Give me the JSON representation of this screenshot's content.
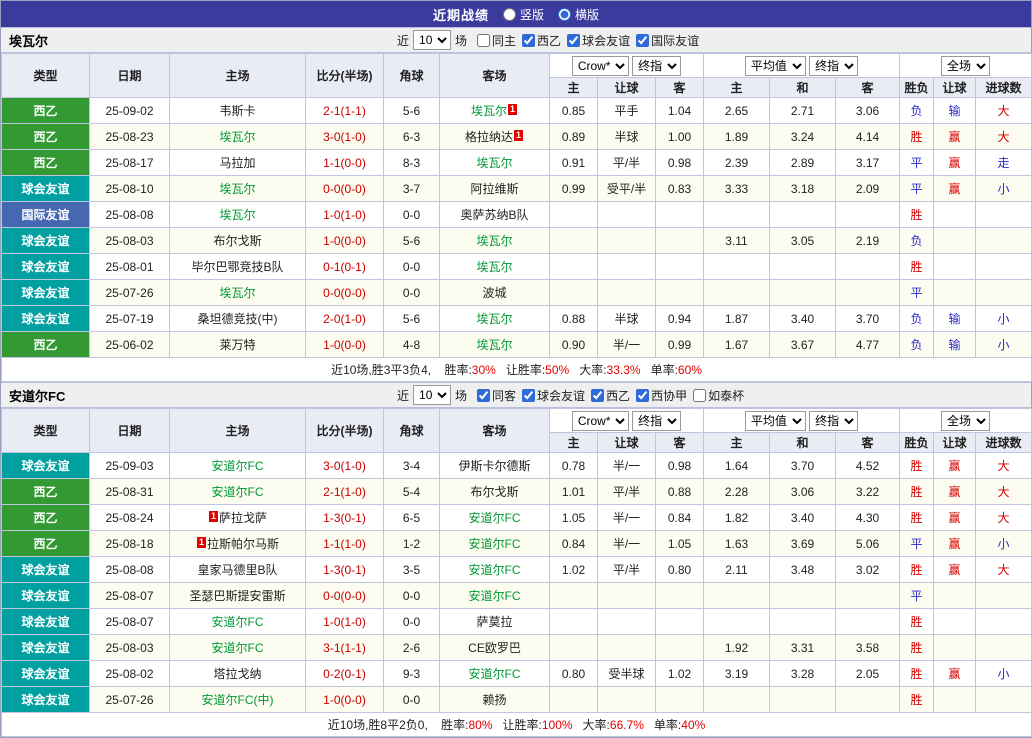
{
  "topbar": {
    "title": "近期战绩",
    "radios": [
      {
        "label": "竖版",
        "selected": false
      },
      {
        "label": "横版",
        "selected": true
      }
    ]
  },
  "columns": {
    "type": "类型",
    "date": "日期",
    "home": "主场",
    "score": "比分(半场)",
    "corner": "角球",
    "away": "客场",
    "sub_odds": [
      "主",
      "让球",
      "客"
    ],
    "sub_avg": [
      "主",
      "和",
      "客"
    ],
    "sub_result": [
      "胜负",
      "让球",
      "进球数"
    ]
  },
  "dropdowns": {
    "company": "Crow*",
    "final": "终指",
    "average": "平均值",
    "fulltime": "全场"
  },
  "type_colors": {
    "西乙": "#339933",
    "球会友谊": "#00a0a0",
    "国际友谊": "#4668b2"
  },
  "sections": [
    {
      "team": "埃瓦尔",
      "filters": {
        "recent_label": "近",
        "count": "10",
        "games_label": "场",
        "checkboxes": [
          {
            "label": "同主",
            "checked": false
          },
          {
            "label": "西乙",
            "checked": true
          },
          {
            "label": "球会友谊",
            "checked": true
          },
          {
            "label": "国际友谊",
            "checked": true
          }
        ]
      },
      "rows": [
        {
          "type": "西乙",
          "date": "25-09-02",
          "home": {
            "name": "韦斯卡"
          },
          "score": "2-1(1-1)",
          "corner": "5-6",
          "away": {
            "name": "埃瓦尔",
            "green": true,
            "card_after": "1"
          },
          "odds": [
            "0.85",
            "平手",
            "1.04"
          ],
          "avg": [
            "2.65",
            "2.71",
            "3.06"
          ],
          "result": [
            [
              "负",
              "blue"
            ],
            [
              "输",
              "blue"
            ],
            [
              "大",
              "red"
            ]
          ]
        },
        {
          "type": "西乙",
          "date": "25-08-23",
          "home": {
            "name": "埃瓦尔",
            "green": true
          },
          "score": "3-0(1-0)",
          "corner": "6-3",
          "away": {
            "name": "格拉纳达",
            "card_after": "1"
          },
          "odds": [
            "0.89",
            "半球",
            "1.00"
          ],
          "avg": [
            "1.89",
            "3.24",
            "4.14"
          ],
          "result": [
            [
              "胜",
              "red"
            ],
            [
              "赢",
              "red"
            ],
            [
              "大",
              "red"
            ]
          ]
        },
        {
          "type": "西乙",
          "date": "25-08-17",
          "home": {
            "name": "马拉加"
          },
          "score": "1-1(0-0)",
          "corner": "8-3",
          "away": {
            "name": "埃瓦尔",
            "green": true
          },
          "odds": [
            "0.91",
            "平/半",
            "0.98"
          ],
          "avg": [
            "2.39",
            "2.89",
            "3.17"
          ],
          "result": [
            [
              "平",
              "blue"
            ],
            [
              "赢",
              "red"
            ],
            [
              "走",
              "blue"
            ]
          ]
        },
        {
          "type": "球会友谊",
          "date": "25-08-10",
          "home": {
            "name": "埃瓦尔",
            "green": true
          },
          "score": "0-0(0-0)",
          "corner": "3-7",
          "away": {
            "name": "阿拉维斯"
          },
          "odds": [
            "0.99",
            "受平/半",
            "0.83"
          ],
          "avg": [
            "3.33",
            "3.18",
            "2.09"
          ],
          "result": [
            [
              "平",
              "blue"
            ],
            [
              "赢",
              "red"
            ],
            [
              "小",
              "blue"
            ]
          ]
        },
        {
          "type": "国际友谊",
          "date": "25-08-08",
          "home": {
            "name": "埃瓦尔",
            "green": true
          },
          "score": "1-0(1-0)",
          "corner": "0-0",
          "away": {
            "name": "奥萨苏纳B队"
          },
          "odds": [
            "",
            "",
            ""
          ],
          "avg": [
            "",
            "",
            ""
          ],
          "result": [
            [
              "胜",
              "red"
            ],
            [
              "",
              ""
            ],
            [
              "",
              ""
            ]
          ]
        },
        {
          "type": "球会友谊",
          "date": "25-08-03",
          "home": {
            "name": "布尔戈斯"
          },
          "score": "1-0(0-0)",
          "corner": "5-6",
          "away": {
            "name": "埃瓦尔",
            "green": true
          },
          "odds": [
            "",
            "",
            ""
          ],
          "avg": [
            "3.11",
            "3.05",
            "2.19"
          ],
          "result": [
            [
              "负",
              "blue"
            ],
            [
              "",
              ""
            ],
            [
              "",
              ""
            ]
          ]
        },
        {
          "type": "球会友谊",
          "date": "25-08-01",
          "home": {
            "name": "毕尔巴鄂竞技B队"
          },
          "score": "0-1(0-1)",
          "corner": "0-0",
          "away": {
            "name": "埃瓦尔",
            "green": true
          },
          "odds": [
            "",
            "",
            ""
          ],
          "avg": [
            "",
            "",
            ""
          ],
          "result": [
            [
              "胜",
              "red"
            ],
            [
              "",
              ""
            ],
            [
              "",
              ""
            ]
          ]
        },
        {
          "type": "球会友谊",
          "date": "25-07-26",
          "home": {
            "name": "埃瓦尔",
            "green": true
          },
          "score": "0-0(0-0)",
          "corner": "0-0",
          "away": {
            "name": "波城"
          },
          "odds": [
            "",
            "",
            ""
          ],
          "avg": [
            "",
            "",
            ""
          ],
          "result": [
            [
              "平",
              "blue"
            ],
            [
              "",
              ""
            ],
            [
              "",
              ""
            ]
          ]
        },
        {
          "type": "球会友谊",
          "date": "25-07-19",
          "home": {
            "name": "桑坦德竞技(中)"
          },
          "score": "2-0(1-0)",
          "corner": "5-6",
          "away": {
            "name": "埃瓦尔",
            "green": true
          },
          "odds": [
            "0.88",
            "半球",
            "0.94"
          ],
          "avg": [
            "1.87",
            "3.40",
            "3.70"
          ],
          "result": [
            [
              "负",
              "blue"
            ],
            [
              "输",
              "blue"
            ],
            [
              "小",
              "blue"
            ]
          ]
        },
        {
          "type": "西乙",
          "date": "25-06-02",
          "home": {
            "name": "莱万特"
          },
          "score": "1-0(0-0)",
          "corner": "4-8",
          "away": {
            "name": "埃瓦尔",
            "green": true
          },
          "odds": [
            "0.90",
            "半/一",
            "0.99"
          ],
          "avg": [
            "1.67",
            "3.67",
            "4.77"
          ],
          "result": [
            [
              "负",
              "blue"
            ],
            [
              "输",
              "blue"
            ],
            [
              "小",
              "blue"
            ]
          ]
        }
      ],
      "summary": {
        "prefix": "近10场,胜3平3负4, ",
        "items": [
          {
            "label": "胜率:",
            "value": "30%"
          },
          {
            "label": "让胜率:",
            "value": "50%"
          },
          {
            "label": "大率:",
            "value": "33.3%"
          },
          {
            "label": "单率:",
            "value": "60%"
          }
        ]
      }
    },
    {
      "team": "安道尔FC",
      "filters": {
        "recent_label": "近",
        "count": "10",
        "games_label": "场",
        "checkboxes": [
          {
            "label": "同客",
            "checked": true
          },
          {
            "label": "球会友谊",
            "checked": true
          },
          {
            "label": "西乙",
            "checked": true
          },
          {
            "label": "西协甲",
            "checked": true
          },
          {
            "label": "如泰杯",
            "checked": false
          }
        ]
      },
      "rows": [
        {
          "type": "球会友谊",
          "date": "25-09-03",
          "home": {
            "name": "安道尔FC",
            "green": true
          },
          "score": "3-0(1-0)",
          "corner": "3-4",
          "away": {
            "name": "伊斯卡尔德斯"
          },
          "odds": [
            "0.78",
            "半/一",
            "0.98"
          ],
          "avg": [
            "1.64",
            "3.70",
            "4.52"
          ],
          "result": [
            [
              "胜",
              "red"
            ],
            [
              "赢",
              "red"
            ],
            [
              "大",
              "red"
            ]
          ]
        },
        {
          "type": "西乙",
          "date": "25-08-31",
          "home": {
            "name": "安道尔FC",
            "green": true
          },
          "score": "2-1(1-0)",
          "corner": "5-4",
          "away": {
            "name": "布尔戈斯"
          },
          "odds": [
            "1.01",
            "平/半",
            "0.88"
          ],
          "avg": [
            "2.28",
            "3.06",
            "3.22"
          ],
          "result": [
            [
              "胜",
              "red"
            ],
            [
              "赢",
              "red"
            ],
            [
              "大",
              "red"
            ]
          ]
        },
        {
          "type": "西乙",
          "date": "25-08-24",
          "home": {
            "name": "萨拉戈萨",
            "card_before": "1"
          },
          "score": "1-3(0-1)",
          "corner": "6-5",
          "away": {
            "name": "安道尔FC",
            "green": true
          },
          "odds": [
            "1.05",
            "半/一",
            "0.84"
          ],
          "avg": [
            "1.82",
            "3.40",
            "4.30"
          ],
          "result": [
            [
              "胜",
              "red"
            ],
            [
              "赢",
              "red"
            ],
            [
              "大",
              "red"
            ]
          ]
        },
        {
          "type": "西乙",
          "date": "25-08-18",
          "home": {
            "name": "拉斯帕尔马斯",
            "card_before": "1"
          },
          "score": "1-1(1-0)",
          "corner": "1-2",
          "away": {
            "name": "安道尔FC",
            "green": true
          },
          "odds": [
            "0.84",
            "半/一",
            "1.05"
          ],
          "avg": [
            "1.63",
            "3.69",
            "5.06"
          ],
          "result": [
            [
              "平",
              "blue"
            ],
            [
              "赢",
              "red"
            ],
            [
              "小",
              "blue"
            ]
          ]
        },
        {
          "type": "球会友谊",
          "date": "25-08-08",
          "home": {
            "name": "皇家马德里B队"
          },
          "score": "1-3(0-1)",
          "corner": "3-5",
          "away": {
            "name": "安道尔FC",
            "green": true
          },
          "odds": [
            "1.02",
            "平/半",
            "0.80"
          ],
          "avg": [
            "2.11",
            "3.48",
            "3.02"
          ],
          "result": [
            [
              "胜",
              "red"
            ],
            [
              "赢",
              "red"
            ],
            [
              "大",
              "red"
            ]
          ]
        },
        {
          "type": "球会友谊",
          "date": "25-08-07",
          "home": {
            "name": "圣瑟巴斯提安雷斯"
          },
          "score": "0-0(0-0)",
          "corner": "0-0",
          "away": {
            "name": "安道尔FC",
            "green": true
          },
          "odds": [
            "",
            "",
            ""
          ],
          "avg": [
            "",
            "",
            ""
          ],
          "result": [
            [
              "平",
              "blue"
            ],
            [
              "",
              ""
            ],
            [
              "",
              ""
            ]
          ]
        },
        {
          "type": "球会友谊",
          "date": "25-08-07",
          "home": {
            "name": "安道尔FC",
            "green": true
          },
          "score": "1-0(1-0)",
          "corner": "0-0",
          "away": {
            "name": "萨莫拉"
          },
          "odds": [
            "",
            "",
            ""
          ],
          "avg": [
            "",
            "",
            ""
          ],
          "result": [
            [
              "胜",
              "red"
            ],
            [
              "",
              ""
            ],
            [
              "",
              ""
            ]
          ]
        },
        {
          "type": "球会友谊",
          "date": "25-08-03",
          "home": {
            "name": "安道尔FC",
            "green": true
          },
          "score": "3-1(1-1)",
          "corner": "2-6",
          "away": {
            "name": "CE欧罗巴"
          },
          "odds": [
            "",
            "",
            ""
          ],
          "avg": [
            "1.92",
            "3.31",
            "3.58"
          ],
          "result": [
            [
              "胜",
              "red"
            ],
            [
              "",
              ""
            ],
            [
              "",
              ""
            ]
          ]
        },
        {
          "type": "球会友谊",
          "date": "25-08-02",
          "home": {
            "name": "塔拉戈纳"
          },
          "score": "0-2(0-1)",
          "corner": "9-3",
          "away": {
            "name": "安道尔FC",
            "green": true
          },
          "odds": [
            "0.80",
            "受半球",
            "1.02"
          ],
          "avg": [
            "3.19",
            "3.28",
            "2.05"
          ],
          "result": [
            [
              "胜",
              "red"
            ],
            [
              "赢",
              "red"
            ],
            [
              "小",
              "blue"
            ]
          ]
        },
        {
          "type": "球会友谊",
          "date": "25-07-26",
          "home": {
            "name": "安道尔FC(中)",
            "green": true
          },
          "score": "1-0(0-0)",
          "corner": "0-0",
          "away": {
            "name": "赖扬"
          },
          "odds": [
            "",
            "",
            ""
          ],
          "avg": [
            "",
            "",
            ""
          ],
          "result": [
            [
              "胜",
              "red"
            ],
            [
              "",
              ""
            ],
            [
              "",
              ""
            ]
          ]
        }
      ],
      "summary": {
        "prefix": "近10场,胜8平2负0, ",
        "items": [
          {
            "label": "胜率:",
            "value": "80%"
          },
          {
            "label": "让胜率:",
            "value": "100%"
          },
          {
            "label": "大率:",
            "value": "66.7%"
          },
          {
            "label": "单率:",
            "value": "40%"
          }
        ]
      }
    }
  ]
}
